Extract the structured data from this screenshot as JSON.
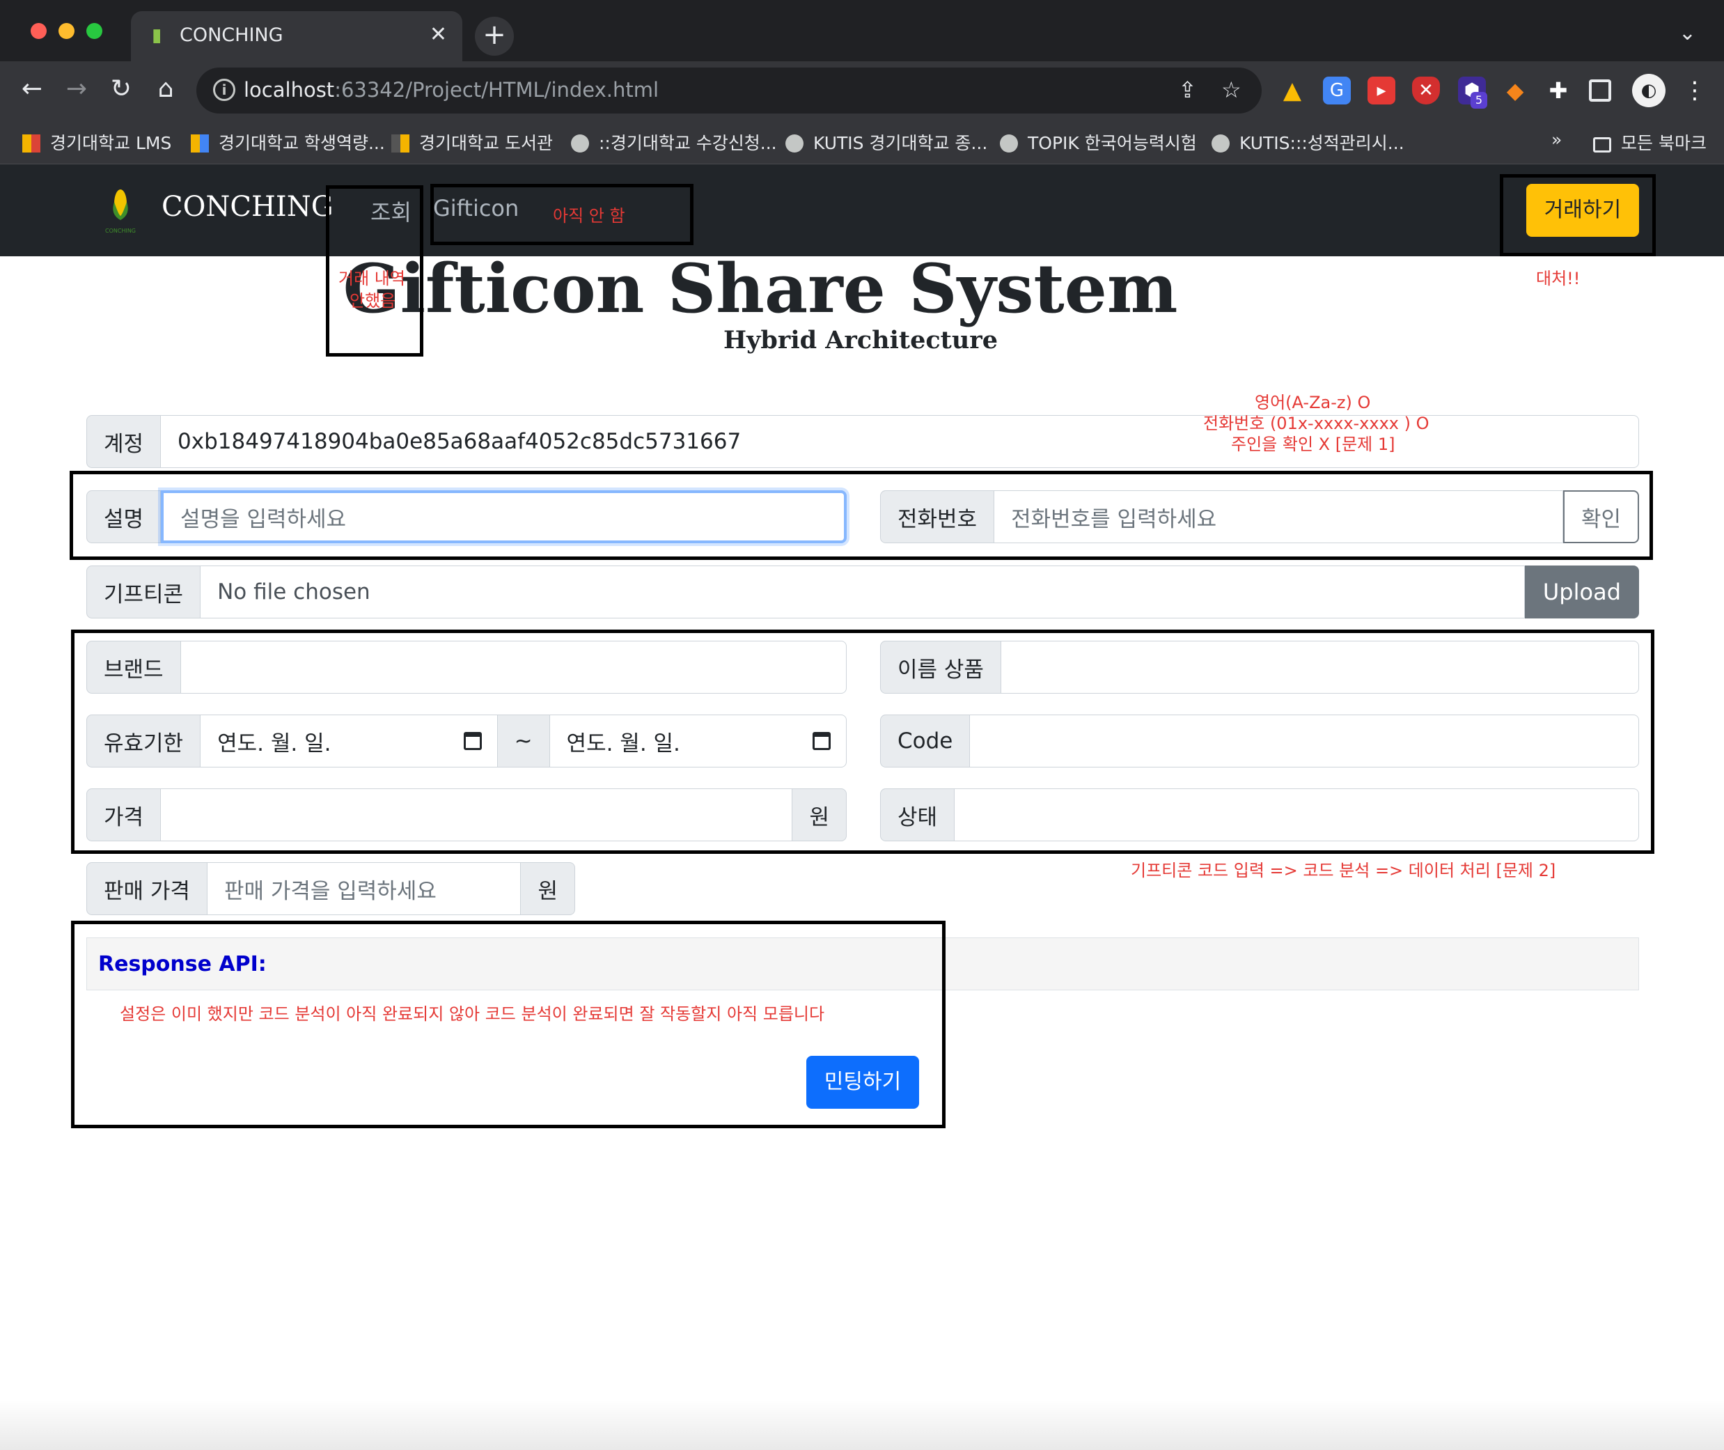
{
  "browser": {
    "tab_title": "CONCHING",
    "url_host": "localhost",
    "url_rest": ":63342/Project/HTML/index.html",
    "bookmarks": [
      "경기대학교 LMS",
      "경기대학교 학생역량...",
      "경기대학교 도서관",
      "::경기대학교 수강신청...",
      "KUTIS 경기대학교 종...",
      "TOPIK 한국어능력시험",
      "KUTIS:::성적관리시..."
    ],
    "bookmarks_overflow": "»",
    "all_bookmarks": "모든 북마크",
    "ext_badge": "5"
  },
  "navbar": {
    "brand": "CONCHING",
    "brand_logo_text": "CONCHING",
    "link_inquiry": "조회",
    "link_gifticon": "Gifticon",
    "trade_button": "거래하기"
  },
  "notes": {
    "nav_not_done": "아직 안 함",
    "trade_history_line1": "거래 내역",
    "trade_history_line2": "안했음",
    "replace": "대처!!",
    "validation_line1": "영어(A-Za-z) O",
    "validation_line2": "전화번호 (01x-xxxx-xxxx ) O",
    "validation_line3": "주인을 확인 X [문제 1]",
    "code_flow": "기프티콘 코드 입력 => 코드 분석 => 데이터 처리  [문제 2]",
    "minting_note": "설정은 이미 했지만 코드 분석이 아직 완료되지 않아 코드 분석이 완료되면 잘 작동할지 아직 모릅니다"
  },
  "header": {
    "title": "Gifticon Share System",
    "subtitle": "Hybrid Architecture"
  },
  "form": {
    "account_label": "계정",
    "account_value": "0xb18497418904ba0e85a68aaf4052c85dc5731667",
    "description_label": "설명",
    "description_placeholder": "설명을 입력하세요",
    "phone_label": "전화번호",
    "phone_placeholder": "전화번호를 입력하세요",
    "confirm_button": "확인",
    "gifticon_label": "기프티콘",
    "file_status": "No file chosen",
    "upload_button": "Upload",
    "brand_label": "브랜드",
    "product_label": "이름 상품",
    "validity_label": "유효기한",
    "date_placeholder": "연도. 월. 일.",
    "date_separator": "~",
    "code_label": "Code",
    "price_label": "가격",
    "won": "원",
    "status_label": "상태",
    "sale_price_label": "판매 가격",
    "sale_price_placeholder": "판매 가격을 입력하세요"
  },
  "response": {
    "title": "Response API:"
  },
  "mint_button": "민팅하기"
}
